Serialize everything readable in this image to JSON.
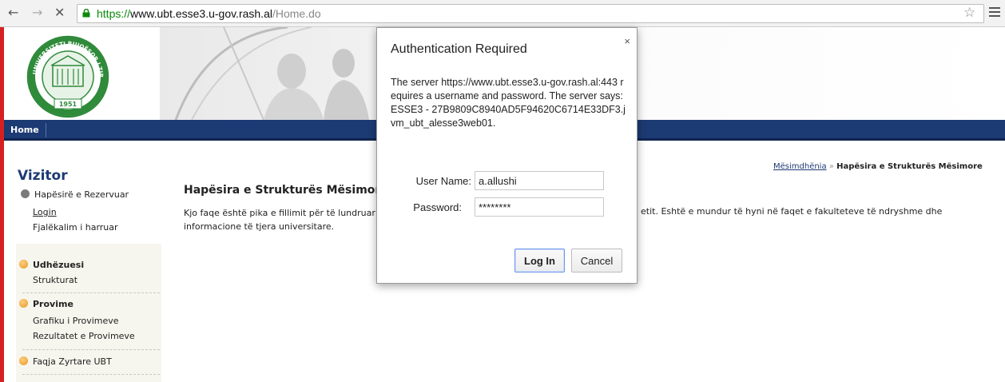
{
  "browser": {
    "url_scheme": "https://",
    "url_host": "www.ubt.esse3.u-gov.rash.al",
    "url_path": "/Home.do",
    "back_icon": "←",
    "forward_icon": "→",
    "stop_icon": "✕",
    "star_icon": "☆"
  },
  "header": {
    "logo_text_top": "UNIVERSITETI BUJQËSOR I TIRANËS",
    "logo_year": "1951"
  },
  "navbar": {
    "home_label": "Home"
  },
  "sidebar": {
    "title": "Vizitor",
    "reserved_label": "Hapësirë e Rezervuar",
    "login_label": "Login",
    "forgot_label": "Fjalëkalim i harruar",
    "guide_label": "Udhëzuesi",
    "structures_label": "Strukturat",
    "exams_label": "Provime",
    "exam_chart_label": "Grafiku i Provimeve",
    "exam_results_label": "Rezultatet e Provimeve",
    "official_page_label": "Faqja Zyrtare UBT"
  },
  "main": {
    "breadcrumb_link": "Mësimdhënia",
    "breadcrumb_sep": "»",
    "breadcrumb_current": "Hapësira e Strukturës Mësimore",
    "page_title": "Hapësira e Strukturës Mësimore",
    "intro_left": "Kjo faqe është pika e fillimit për të lundruar informacione të tjera universitare.",
    "intro_right": "etit. Eshtë e mundur të hyni në faqet e fakulteteve të ndryshme dhe"
  },
  "dialog": {
    "title": "Authentication Required",
    "close_icon": "×",
    "message": "The server https://www.ubt.esse3.u-gov.rash.al:443 requires a username and password. The server says: ESSE3 - 27B9809C8940AD5F94620C6714E33DF3.jvm_ubt_alesse3web01.",
    "username_label": "User Name:",
    "username_value": "a.allushi",
    "password_label": "Password:",
    "password_value": "********",
    "login_button": "Log In",
    "cancel_button": "Cancel"
  },
  "colors": {
    "navbar": "#1c3a73",
    "accent_red": "#d62020",
    "logo_green": "#2f8a3a",
    "bullet_orange": "#e89420"
  }
}
